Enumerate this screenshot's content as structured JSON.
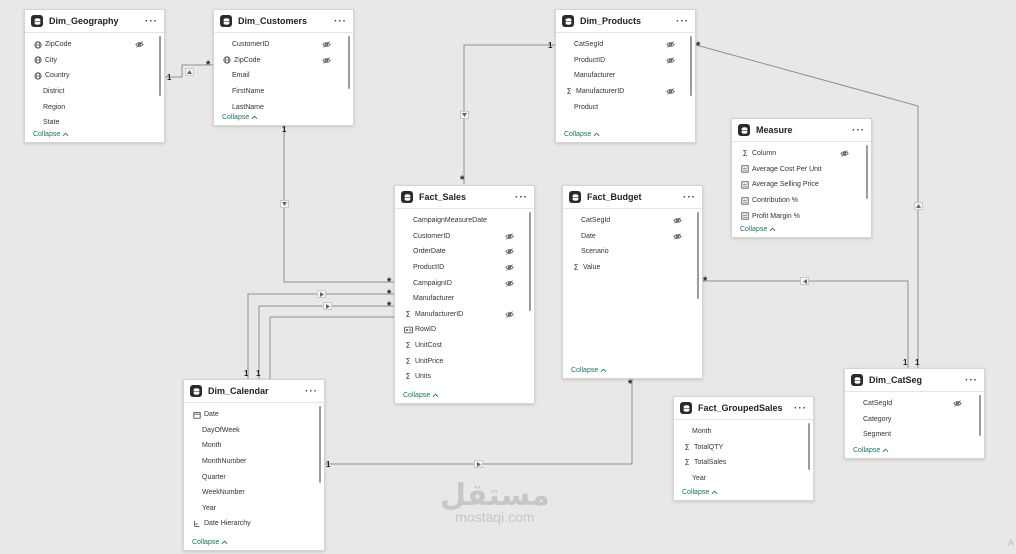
{
  "tables": [
    {
      "id": "geo",
      "title": "Dim_Geography",
      "collapse": "Collapse",
      "fields": [
        {
          "name": "ZipCode",
          "icon": "globe",
          "hidden": true
        },
        {
          "name": "City",
          "icon": "globe",
          "hidden": false
        },
        {
          "name": "Country",
          "icon": "globe",
          "hidden": false
        },
        {
          "name": "District",
          "icon": "",
          "hidden": false
        },
        {
          "name": "Region",
          "icon": "",
          "hidden": false
        },
        {
          "name": "State",
          "icon": "",
          "hidden": false
        }
      ]
    },
    {
      "id": "cust",
      "title": "Dim_Customers",
      "collapse": "Collapse",
      "fields": [
        {
          "name": "CustomerID",
          "icon": "",
          "hidden": true
        },
        {
          "name": "ZipCode",
          "icon": "globe",
          "hidden": true
        },
        {
          "name": "Email",
          "icon": "",
          "hidden": false
        },
        {
          "name": "FirstName",
          "icon": "",
          "hidden": false
        },
        {
          "name": "LastName",
          "icon": "",
          "hidden": false
        }
      ]
    },
    {
      "id": "prod",
      "title": "Dim_Products",
      "collapse": "Collapse",
      "fields": [
        {
          "name": "CatSegId",
          "icon": "",
          "hidden": true
        },
        {
          "name": "ProductID",
          "icon": "",
          "hidden": true
        },
        {
          "name": "Manufacturer",
          "icon": "",
          "hidden": false
        },
        {
          "name": "ManufacturerID",
          "icon": "sigma",
          "hidden": true
        },
        {
          "name": "Product",
          "icon": "",
          "hidden": false
        }
      ]
    },
    {
      "id": "measure",
      "title": "Measure",
      "collapse": "Collapse",
      "fields": [
        {
          "name": "Column",
          "icon": "sigma",
          "hidden": true
        },
        {
          "name": "Average Cost Per Unit",
          "icon": "calc",
          "hidden": false
        },
        {
          "name": "Average Selling Price",
          "icon": "calc",
          "hidden": false
        },
        {
          "name": "Contribution %",
          "icon": "calc",
          "hidden": false
        },
        {
          "name": "Profit Margin %",
          "icon": "calc",
          "hidden": false
        }
      ]
    },
    {
      "id": "sales",
      "title": "Fact_Sales",
      "collapse": "Collapse",
      "fields": [
        {
          "name": "CampaignMeasureDate",
          "icon": "",
          "hidden": false
        },
        {
          "name": "CustomerID",
          "icon": "",
          "hidden": true
        },
        {
          "name": "OrderDate",
          "icon": "",
          "hidden": true
        },
        {
          "name": "ProductID",
          "icon": "",
          "hidden": true
        },
        {
          "name": "CampaignID",
          "icon": "",
          "hidden": true
        },
        {
          "name": "Manufacturer",
          "icon": "",
          "hidden": false
        },
        {
          "name": "ManufacturerID",
          "icon": "sigma",
          "hidden": true
        },
        {
          "name": "RowID",
          "icon": "id",
          "hidden": false
        },
        {
          "name": "UnitCost",
          "icon": "sigma",
          "hidden": false
        },
        {
          "name": "UnitPrice",
          "icon": "sigma",
          "hidden": false
        },
        {
          "name": "Units",
          "icon": "sigma",
          "hidden": false
        }
      ]
    },
    {
      "id": "budget",
      "title": "Fact_Budget",
      "collapse": "Collapse",
      "fields": [
        {
          "name": "CatSegId",
          "icon": "",
          "hidden": true
        },
        {
          "name": "Date",
          "icon": "",
          "hidden": true
        },
        {
          "name": "Scenario",
          "icon": "",
          "hidden": false
        },
        {
          "name": "Value",
          "icon": "sigma",
          "hidden": false
        }
      ]
    },
    {
      "id": "calendar",
      "title": "Dim_Calendar",
      "collapse": "Collapse",
      "fields": [
        {
          "name": "Date",
          "icon": "cal",
          "hidden": false
        },
        {
          "name": "DayOfWeek",
          "icon": "",
          "hidden": false
        },
        {
          "name": "Month",
          "icon": "",
          "hidden": false
        },
        {
          "name": "MonthNumber",
          "icon": "",
          "hidden": false
        },
        {
          "name": "Quarter",
          "icon": "",
          "hidden": false
        },
        {
          "name": "WeekNumber",
          "icon": "",
          "hidden": false
        },
        {
          "name": "Year",
          "icon": "",
          "hidden": false
        },
        {
          "name": "Date Hierarchy",
          "icon": "hier",
          "hidden": false
        }
      ]
    },
    {
      "id": "grouped",
      "title": "Fact_GroupedSales",
      "collapse": "Collapse",
      "fields": [
        {
          "name": "Month",
          "icon": "",
          "hidden": false
        },
        {
          "name": "TotalQTY",
          "icon": "sigma",
          "hidden": false
        },
        {
          "name": "TotalSales",
          "icon": "sigma",
          "hidden": false
        },
        {
          "name": "Year",
          "icon": "",
          "hidden": false
        }
      ]
    },
    {
      "id": "catseg",
      "title": "Dim_CatSeg",
      "collapse": "Collapse",
      "fields": [
        {
          "name": "CatSegId",
          "icon": "",
          "hidden": true
        },
        {
          "name": "Category",
          "icon": "",
          "hidden": false
        },
        {
          "name": "Segment",
          "icon": "",
          "hidden": false
        }
      ]
    }
  ],
  "relationship_labels": {
    "one": "1",
    "many": "*"
  },
  "watermark": {
    "arabic": "مستقل",
    "latin": "mostaqi.com"
  },
  "corner_text": "A"
}
